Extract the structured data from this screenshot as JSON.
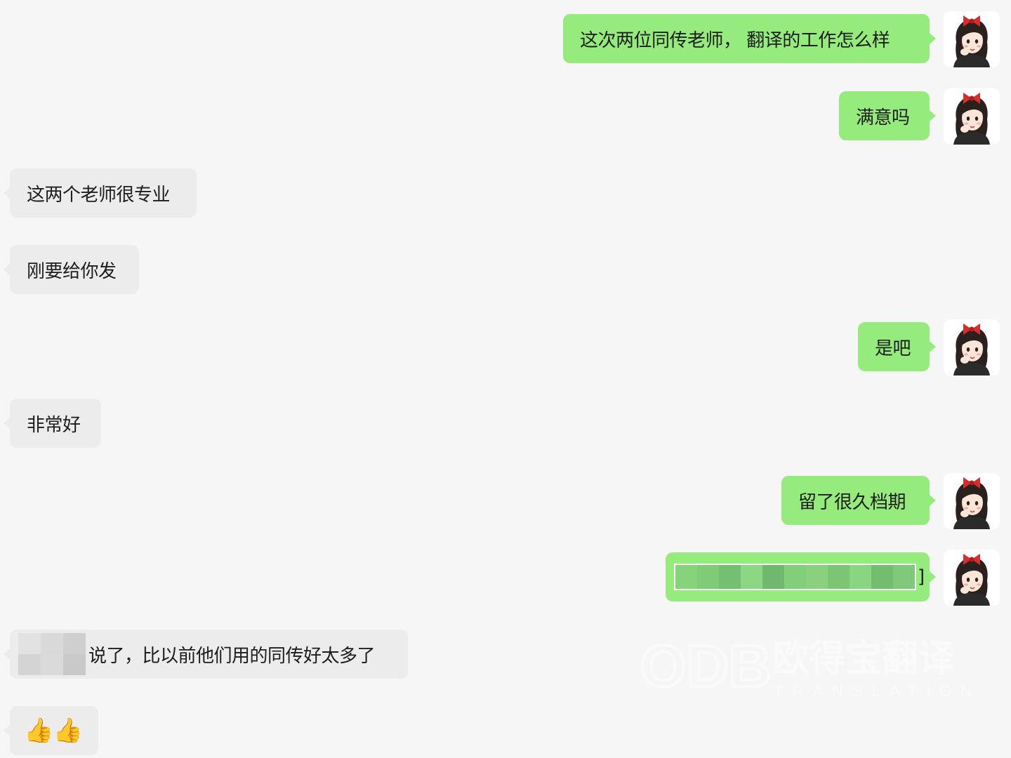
{
  "chat": {
    "messages": [
      {
        "side": "out",
        "text": "这次两位同传老师， 翻译的工作怎么样"
      },
      {
        "side": "out",
        "text": "满意吗"
      },
      {
        "side": "in",
        "text": "这两个老师很专业"
      },
      {
        "side": "in",
        "text": "刚要给你发"
      },
      {
        "side": "out",
        "text": "是吧"
      },
      {
        "side": "in",
        "text": "非常好"
      },
      {
        "side": "out",
        "text": "留了很久档期"
      },
      {
        "side": "out",
        "text": "]"
      },
      {
        "side": "in",
        "text": "说了，比以前他们用的同传好太多了"
      },
      {
        "side": "in",
        "text": "👍👍"
      }
    ]
  },
  "watermark": {
    "logo": "ODB",
    "name": "欧得宝翻译",
    "tagline": "TRANSLATION"
  },
  "colors": {
    "background": "#f6f6f6",
    "outgoing_bubble": "#95ec7d",
    "incoming_bubble": "#ececec",
    "text": "#1d1d1d"
  },
  "icons": {
    "avatar": "cartoon-girl-with-red-bow-avatar",
    "thumbs_up": "thumbs-up-emoji"
  }
}
